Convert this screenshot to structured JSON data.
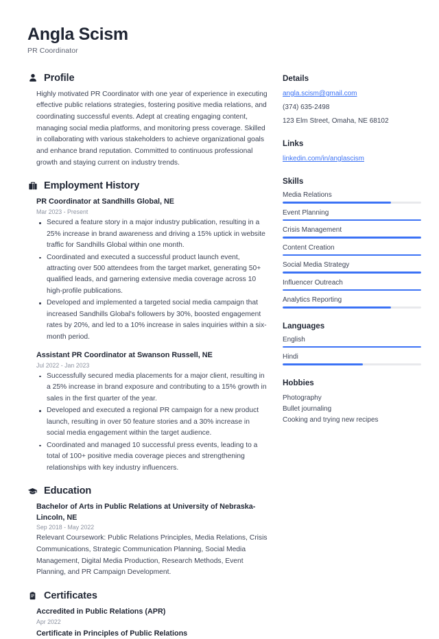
{
  "header": {
    "name": "Angla Scism",
    "job_title": "PR Coordinator"
  },
  "accent_color": "#3b72f5",
  "track_color": "#e8e9ec",
  "sections": {
    "profile": {
      "title": "Profile",
      "icon": "user-icon",
      "text": "Highly motivated PR Coordinator with one year of experience in executing effective public relations strategies, fostering positive media relations, and coordinating successful events. Adept at creating engaging content, managing social media platforms, and monitoring press coverage. Skilled in collaborating with various stakeholders to achieve organizational goals and enhance brand reputation. Committed to continuous professional growth and staying current on industry trends."
    },
    "employment": {
      "title": "Employment History",
      "icon": "briefcase-icon",
      "entries": [
        {
          "title": "PR Coordinator at Sandhills Global, NE",
          "date": "Mar 2023 - Present",
          "bullets": [
            "Secured a feature story in a major industry publication, resulting in a 25% increase in brand awareness and driving a 15% uptick in website traffic for Sandhills Global within one month.",
            "Coordinated and executed a successful product launch event, attracting over 500 attendees from the target market, generating 50+ qualified leads, and garnering extensive media coverage across 10 high-profile publications.",
            "Developed and implemented a targeted social media campaign that increased Sandhills Global's followers by 30%, boosted engagement rates by 20%, and led to a 10% increase in sales inquiries within a six-month period."
          ]
        },
        {
          "title": "Assistant PR Coordinator at Swanson Russell, NE",
          "date": "Jul 2022 - Jan 2023",
          "bullets": [
            "Successfully secured media placements for a major client, resulting in a 25% increase in brand exposure and contributing to a 15% growth in sales in the first quarter of the year.",
            "Developed and executed a regional PR campaign for a new product launch, resulting in over 50 feature stories and a 30% increase in social media engagement within the target audience.",
            "Coordinated and managed 10 successful press events, leading to a total of 100+ positive media coverage pieces and strengthening relationships with key industry influencers."
          ]
        }
      ]
    },
    "education": {
      "title": "Education",
      "icon": "graduation-cap-icon",
      "entries": [
        {
          "title": "Bachelor of Arts in Public Relations at University of Nebraska-Lincoln, NE",
          "date": "Sep 2018 - May 2022",
          "description": "Relevant Coursework: Public Relations Principles, Media Relations, Crisis Communications, Strategic Communication Planning, Social Media Management, Digital Media Production, Research Methods, Event Planning, and PR Campaign Development."
        }
      ]
    },
    "certificates": {
      "title": "Certificates",
      "icon": "clipboard-icon",
      "entries": [
        {
          "title": "Accredited in Public Relations (APR)",
          "date": "Apr 2022"
        },
        {
          "title": "Certificate in Principles of Public Relations",
          "date": ""
        }
      ]
    }
  },
  "sidebar": {
    "details": {
      "title": "Details",
      "email": "angla.scism@gmail.com",
      "phone": "(374) 635-2498",
      "address": "123 Elm Street, Omaha, NE 68102"
    },
    "links": {
      "title": "Links",
      "items": [
        {
          "label": "linkedin.com/in/anglascism"
        }
      ]
    },
    "skills": {
      "title": "Skills",
      "items": [
        {
          "label": "Media Relations",
          "level": 78
        },
        {
          "label": "Event Planning",
          "level": 100
        },
        {
          "label": "Crisis Management",
          "level": 100
        },
        {
          "label": "Content Creation",
          "level": 100
        },
        {
          "label": "Social Media Strategy",
          "level": 100
        },
        {
          "label": "Influencer Outreach",
          "level": 100
        },
        {
          "label": "Analytics Reporting",
          "level": 78
        }
      ]
    },
    "languages": {
      "title": "Languages",
      "items": [
        {
          "label": "English",
          "level": 100
        },
        {
          "label": "Hindi",
          "level": 58
        }
      ]
    },
    "hobbies": {
      "title": "Hobbies",
      "items": [
        {
          "label": "Photography"
        },
        {
          "label": "Bullet journaling"
        },
        {
          "label": "Cooking and trying new recipes"
        }
      ]
    }
  }
}
